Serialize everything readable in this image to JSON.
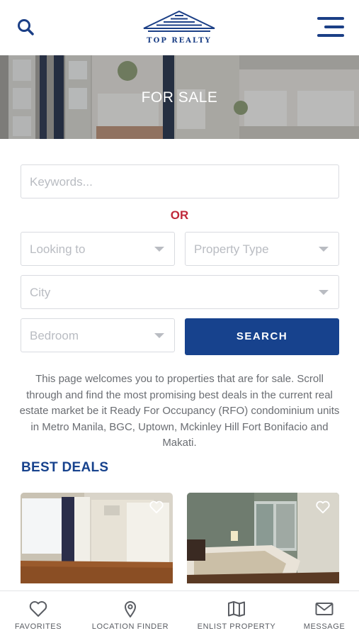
{
  "header": {
    "logo_text": "TOP REALTY",
    "search_icon": "search-icon",
    "menu_icon": "hamburger-menu-icon"
  },
  "hero": {
    "title": "FOR SALE"
  },
  "search_form": {
    "keywords_placeholder": "Keywords...",
    "or_label": "OR",
    "looking_to_placeholder": "Looking to",
    "property_type_placeholder": "Property Type",
    "city_placeholder": "City",
    "bedroom_placeholder": "Bedroom",
    "search_button_label": "SEARCH"
  },
  "intro_text": "This page welcomes you to properties that are for sale. Scroll through and find the most promising best deals in the current real estate market be it Ready For Occupancy (RFO) condominium units in Metro Manila, BGC, Uptown, Mckinley Hill Fort Bonifacio and Makati.",
  "best_deals": {
    "title": "BEST DEALS",
    "cards": [
      {
        "image": "empty-condo-room-photo",
        "favorite_icon": "heart-icon"
      },
      {
        "image": "bedroom-photo",
        "favorite_icon": "heart-icon"
      }
    ]
  },
  "bottom_nav": [
    {
      "label": "FAVORITES",
      "icon": "heart-icon"
    },
    {
      "label": "LOCATION FINDER",
      "icon": "map-pin-icon"
    },
    {
      "label": "ENLIST PROPERTY",
      "icon": "map-icon"
    },
    {
      "label": "MESSAGE",
      "icon": "envelope-icon"
    }
  ],
  "colors": {
    "brand_blue": "#17428d",
    "accent_red": "#c0283a",
    "placeholder_gray": "#b9bcc2"
  }
}
